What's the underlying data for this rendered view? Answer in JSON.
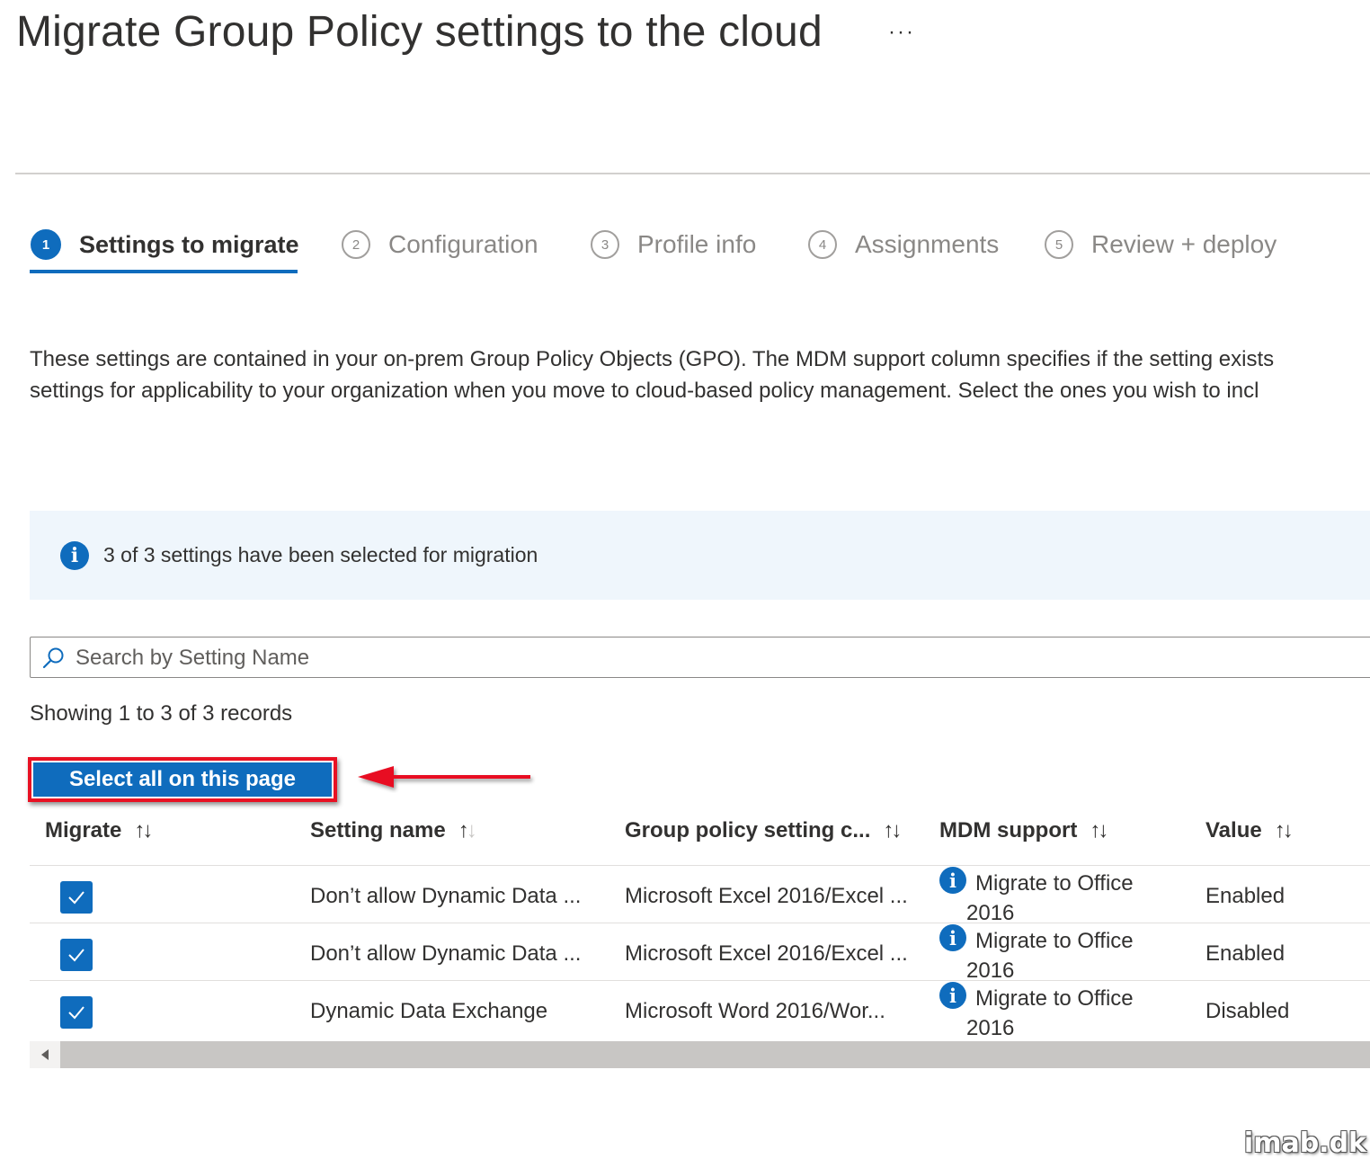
{
  "page": {
    "title": "Migrate Group Policy settings to the cloud",
    "more_label": "···"
  },
  "steps": [
    {
      "number": "1",
      "label": "Settings to migrate",
      "active": true
    },
    {
      "number": "2",
      "label": "Configuration"
    },
    {
      "number": "3",
      "label": "Profile info"
    },
    {
      "number": "4",
      "label": "Assignments"
    },
    {
      "number": "5",
      "label": "Review + deploy"
    }
  ],
  "description": {
    "line1": "These settings are contained in your on-prem Group Policy Objects (GPO). The MDM support column specifies if the setting exists",
    "line2": "settings for applicability to your organization when you move to cloud-based policy management. Select the ones you wish to incl"
  },
  "info_bar": {
    "icon": "info-icon",
    "text": "3 of 3 settings have been selected for migration"
  },
  "search": {
    "placeholder": "Search by Setting Name",
    "value": ""
  },
  "records_text": "Showing 1 to 3 of 3 records",
  "select_all_label": "Select all on this page",
  "table": {
    "headers": {
      "migrate": "Migrate",
      "setting_name": "Setting name",
      "group_policy": "Group policy setting c...",
      "mdm_support": "MDM support",
      "value": "Value"
    },
    "sort_glyph_up": "↑",
    "sort_glyph_down": "↓",
    "rows": [
      {
        "checked": true,
        "setting_name": "Don’t allow Dynamic Data ...",
        "group_policy": "Microsoft Excel 2016/Excel ...",
        "mdm_line1": "Migrate to Office",
        "mdm_line2": "2016",
        "value": "Enabled"
      },
      {
        "checked": true,
        "setting_name": "Don’t allow Dynamic Data ...",
        "group_policy": "Microsoft Excel 2016/Excel ...",
        "mdm_line1": "Migrate to Office",
        "mdm_line2": "2016",
        "value": "Enabled"
      },
      {
        "checked": true,
        "setting_name": "Dynamic Data Exchange",
        "group_policy": "Microsoft Word 2016/Wor...",
        "mdm_line1": "Migrate to Office",
        "mdm_line2": "2016",
        "value": "Disabled"
      }
    ]
  },
  "watermark": "imab.dk",
  "colors": {
    "accent": "#0f6cbd",
    "highlight_red": "#e81123",
    "info_bg": "#eff6fc"
  }
}
